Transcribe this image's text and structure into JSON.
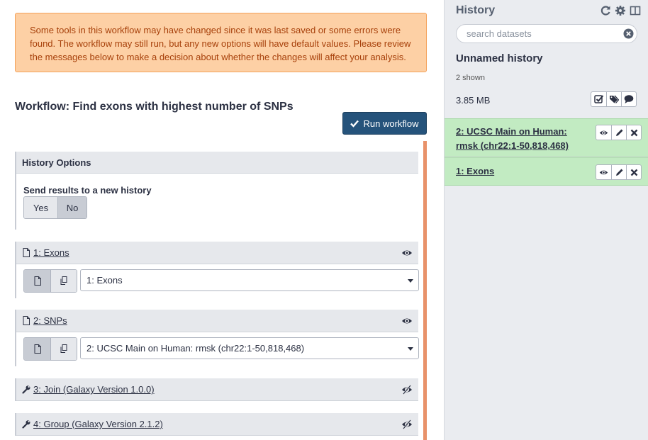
{
  "warning": {
    "line1": "Some tools in this workflow may have changed since it was last saved or some errors were",
    "line2": "found. The workflow may still run, but any new options will have default values. Please review",
    "line3": "the messages below to make a decision about whether the changes will affect your analysis."
  },
  "workflow": {
    "title": "Workflow: Find exons with highest number of SNPs",
    "run_label": "Run workflow"
  },
  "history_options": {
    "header": "History Options",
    "label": "Send results to a new history",
    "yes": "Yes",
    "no": "No"
  },
  "steps": [
    {
      "title": "1: Exons",
      "selected": "1: Exons"
    },
    {
      "title": "2: SNPs",
      "selected": "2: UCSC Main on Human: rmsk (chr22:1-50,818,468)"
    },
    {
      "title": "3: Join (Galaxy Version 1.0.0)"
    },
    {
      "title": "4: Group (Galaxy Version 2.1.2)"
    }
  ],
  "history": {
    "panel_title": "History",
    "search_placeholder": "search datasets",
    "name": "Unnamed history",
    "shown": "2 shown",
    "size": "3.85 MB",
    "datasets": [
      {
        "title": "2: UCSC Main on Human: rmsk (chr22:1-50,818,468)"
      },
      {
        "title": "1: Exons"
      }
    ]
  },
  "colors": {
    "run_button": "#25537b",
    "warning_bg": "#fdd0a5",
    "dataset_ok": "#c2ebc2"
  }
}
